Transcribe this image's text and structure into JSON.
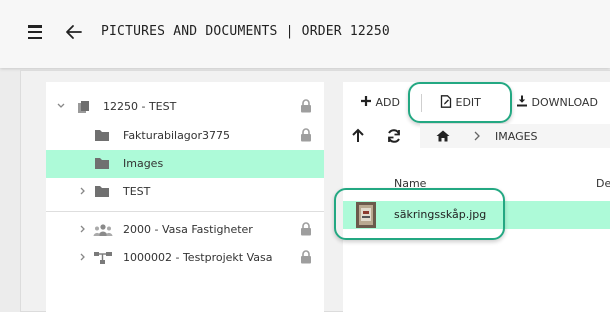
{
  "header": {
    "title": "PICTURES AND DOCUMENTS | ORDER 12250",
    "menu_icon": "hamburger-icon",
    "back_icon": "arrow-left-icon"
  },
  "tree": {
    "items": [
      {
        "label": "12250 - TEST",
        "icon": "file-stack-icon",
        "expanded": true,
        "locked": true
      },
      {
        "label": "Fakturabilagor3775",
        "icon": "folder-icon",
        "locked": true
      },
      {
        "label": "Images",
        "icon": "folder-icon",
        "selected": true
      },
      {
        "label": "TEST",
        "icon": "folder-icon",
        "expanded": false
      },
      {
        "label": "2000 - Vasa Fastigheter",
        "icon": "users-icon",
        "expanded": false,
        "locked": true
      },
      {
        "label": "1000002 - Testprojekt Vasa",
        "icon": "hierarchy-icon",
        "expanded": false,
        "locked": true
      }
    ]
  },
  "toolbar": {
    "add_label": "ADD",
    "edit_label": "EDIT",
    "download_label": "DOWNLOAD"
  },
  "breadcrumb": {
    "current": "IMAGES"
  },
  "table": {
    "columns": [
      "Name",
      "De"
    ],
    "rows": [
      {
        "name": "säkringsskåp.jpg",
        "selected": true
      }
    ]
  },
  "colors": {
    "selection": "#adfad8",
    "highlight_ring": "#23a882"
  }
}
